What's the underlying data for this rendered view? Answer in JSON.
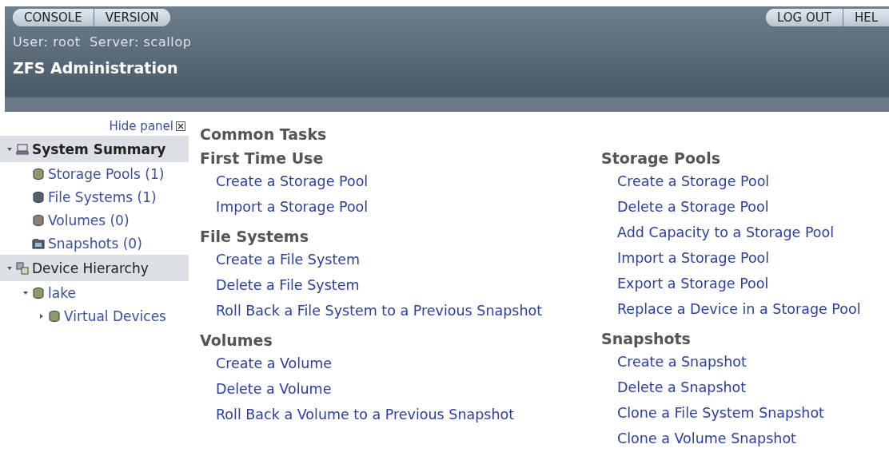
{
  "header": {
    "buttons_left": [
      "CONSOLE",
      "VERSION"
    ],
    "buttons_right": [
      "LOG OUT",
      "HEL"
    ],
    "user_line": "User: root  Server: scallop",
    "title": "ZFS Administration"
  },
  "sidebar": {
    "hide_panel": "Hide panel",
    "tree": [
      {
        "label": "System Summary",
        "kind": "summary",
        "expanded": true,
        "selected": true,
        "children": [
          {
            "label": "Storage Pools (1)",
            "kind": "pool"
          },
          {
            "label": "File Systems (1)",
            "kind": "filesystem"
          },
          {
            "label": "Volumes (0)",
            "kind": "volume"
          },
          {
            "label": "Snapshots (0)",
            "kind": "snapshot"
          }
        ]
      },
      {
        "label": "Device Hierarchy",
        "kind": "hierarchy",
        "expanded": true,
        "selected": false,
        "children": [
          {
            "label": "lake",
            "kind": "pool",
            "expanded": true,
            "children": [
              {
                "label": "Virtual Devices",
                "kind": "pool",
                "expanded": false
              }
            ]
          }
        ]
      }
    ]
  },
  "content": {
    "title": "Common Tasks",
    "columns": [
      [
        {
          "heading": "First Time Use",
          "links": [
            "Create a Storage Pool",
            "Import a Storage Pool"
          ]
        },
        {
          "heading": "File Systems",
          "links": [
            "Create a File System",
            "Delete a File System",
            "Roll Back a File System to a Previous Snapshot"
          ]
        },
        {
          "heading": "Volumes",
          "links": [
            "Create a Volume",
            "Delete a Volume",
            "Roll Back a Volume to a Previous Snapshot"
          ]
        }
      ],
      [
        {
          "heading": "Storage Pools",
          "links": [
            "Create a Storage Pool",
            "Delete a Storage Pool",
            "Add Capacity to a Storage Pool",
            "Import a Storage Pool",
            "Export a Storage Pool",
            "Replace a Device in a Storage Pool"
          ]
        },
        {
          "heading": "Snapshots",
          "links": [
            "Create a Snapshot",
            "Delete a Snapshot",
            "Clone a File System Snapshot",
            "Clone a Volume Snapshot"
          ]
        }
      ]
    ]
  }
}
